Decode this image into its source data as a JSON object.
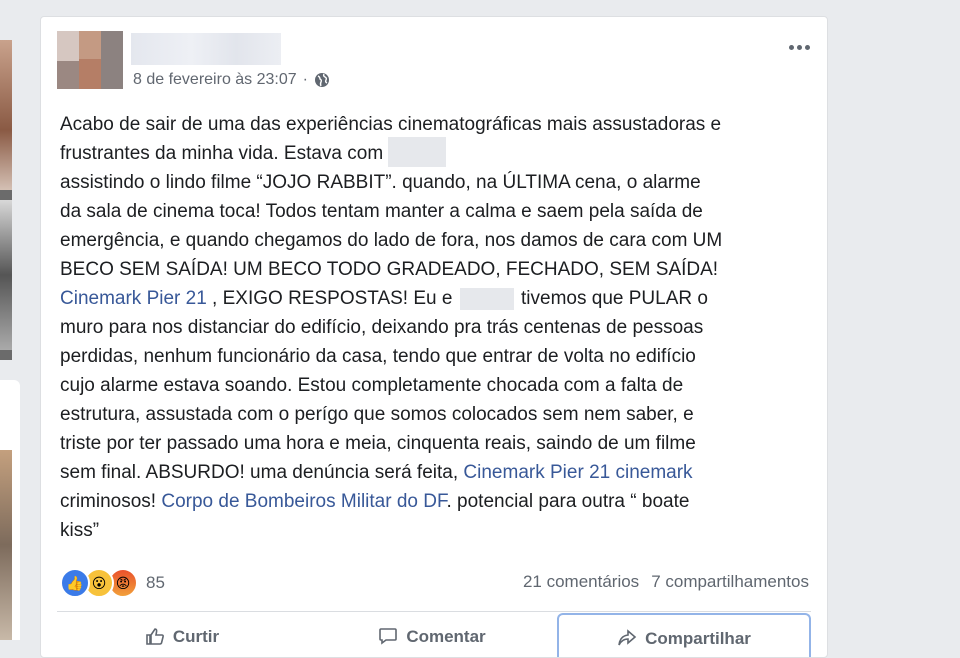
{
  "post": {
    "timestamp": "8 de fevereiro às 23:07",
    "separator": "·",
    "body": {
      "l1": "Acabo de sair de uma das experiências cinematográficas mais assustadoras e",
      "l2": "frustrantes da minha vida. Estava com",
      "l3": "assistindo o lindo filme “JOJO RABBIT”. quando, na ÚLTIMA cena, o alarme",
      "l4": "da sala de cinema toca! Todos tentam manter a calma e saem pela saída de",
      "l5": "emergência, e quando chegamos do lado de fora, nos damos de cara com UM",
      "l6": "BECO SEM SAÍDA! UM BECO TODO GRADEADO, FECHADO, SEM SAÍDA!",
      "l7_link": "Cinemark Pier 21",
      "l7a": " , EXIGO RESPOSTAS! Eu e",
      "l7b": "tivemos que PULAR o",
      "l8": "muro para nos distanciar do edifício, deixando pra trás centenas de pessoas",
      "l9": "perdidas, nenhum funcionário da casa, tendo que entrar de volta no edifício",
      "l10": "cujo alarme estava soando. Estou completamente chocada com a falta de",
      "l11": "estrutura, assustada com o perígo que somos colocados sem nem saber, e",
      "l12": "triste por ter passado uma hora e meia, cinquenta reais, saindo de um filme",
      "l13a": "sem final. ABSURDO! uma denúncia será feita, ",
      "l13_link": "Cinemark Pier 21 cinemark",
      "l14a": "criminosos! ",
      "l14_link": "Corpo de Bombeiros Militar do DF",
      "l14b": ". potencial para outra “ boate",
      "l15": "kiss”"
    },
    "reaction_count": "85",
    "comments": "21 comentários",
    "shares": "7 compartilhamentos",
    "actions": {
      "like": "Curtir",
      "comment": "Comentar",
      "share": "Compartilhar"
    }
  },
  "colors": {
    "link": "#385898",
    "muted": "#616770",
    "text": "#1c1e21"
  },
  "icons": [
    "globe-icon",
    "more-options-icon",
    "like-reaction-icon",
    "wow-reaction-icon",
    "angry-reaction-icon",
    "like-icon",
    "comment-icon",
    "share-icon"
  ]
}
